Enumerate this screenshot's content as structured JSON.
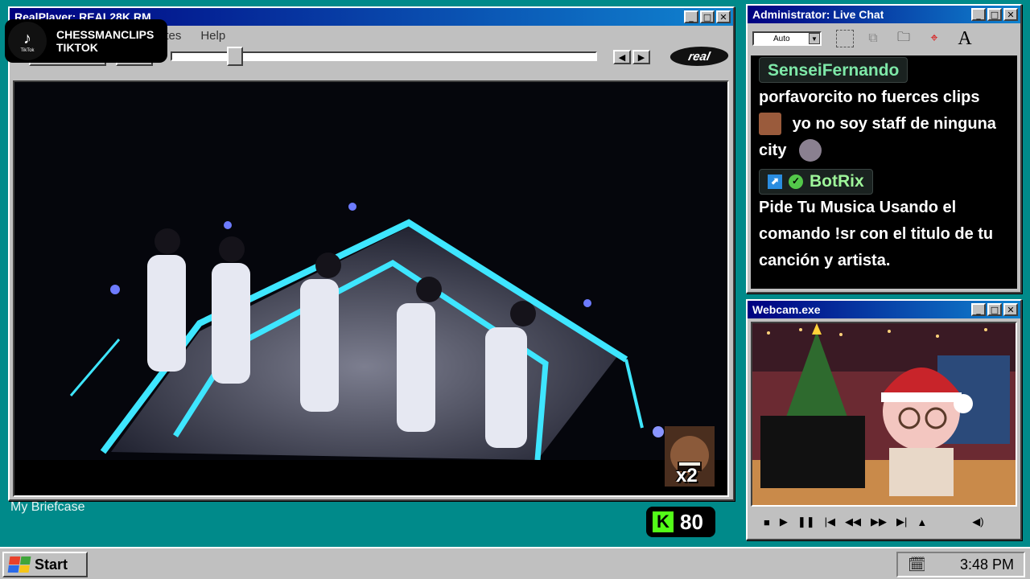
{
  "player": {
    "title": "RealPlayer: REAL28K.RM",
    "menu": [
      "ites",
      "Help"
    ],
    "logo": "real",
    "video_description_icon": "esports-team-stage"
  },
  "desktop": {
    "briefcase_label": "My Briefcase"
  },
  "tiktok": {
    "line1": "CHESSMANCLIPS",
    "line2": "TIKTOK",
    "logo_text": "TikTok"
  },
  "kick": {
    "logo": "K",
    "viewers": "80",
    "color": "#53fc18"
  },
  "emote_overlay": {
    "multiplier": "x2"
  },
  "chat": {
    "title": "Administrator: Live Chat",
    "font_size_value": "Auto",
    "messages": [
      {
        "user": "SenseiFernando",
        "text1": "porfavorcito no fuerces clips",
        "text2": "yo no soy staff de ninguna",
        "text3": "city"
      },
      {
        "user": "BotRix",
        "line1": "Pide Tu Musica Usando el",
        "line2": "comando !sr con el titulo de tu",
        "line3": "canción y artista."
      }
    ]
  },
  "webcam": {
    "title": "Webcam.exe"
  },
  "taskbar": {
    "start_label": "Start",
    "clock": "3:48 PM"
  },
  "colors": {
    "desktop": "#008a8a",
    "titlebar": "#000080",
    "chrome": "#c0c0c0"
  }
}
